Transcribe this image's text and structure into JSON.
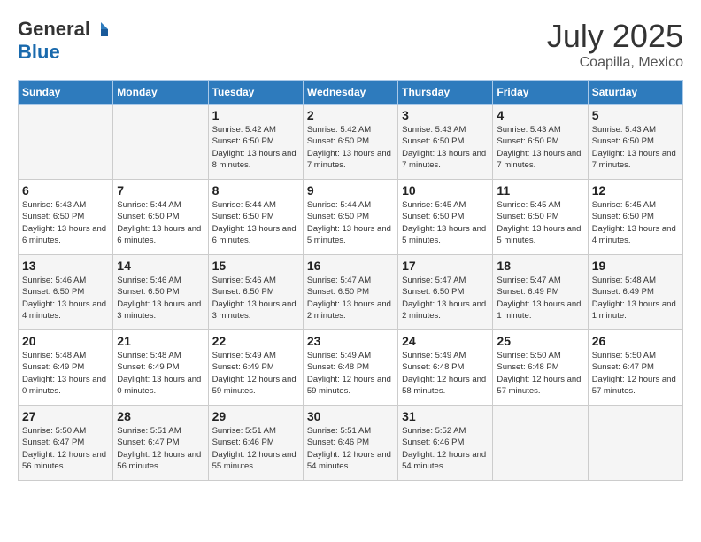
{
  "header": {
    "logo_general": "General",
    "logo_blue": "Blue",
    "title": "July 2025",
    "subtitle": "Coapilla, Mexico"
  },
  "weekdays": [
    "Sunday",
    "Monday",
    "Tuesday",
    "Wednesday",
    "Thursday",
    "Friday",
    "Saturday"
  ],
  "weeks": [
    [
      {
        "day": "",
        "detail": ""
      },
      {
        "day": "",
        "detail": ""
      },
      {
        "day": "1",
        "detail": "Sunrise: 5:42 AM\nSunset: 6:50 PM\nDaylight: 13 hours\nand 8 minutes."
      },
      {
        "day": "2",
        "detail": "Sunrise: 5:42 AM\nSunset: 6:50 PM\nDaylight: 13 hours\nand 7 minutes."
      },
      {
        "day": "3",
        "detail": "Sunrise: 5:43 AM\nSunset: 6:50 PM\nDaylight: 13 hours\nand 7 minutes."
      },
      {
        "day": "4",
        "detail": "Sunrise: 5:43 AM\nSunset: 6:50 PM\nDaylight: 13 hours\nand 7 minutes."
      },
      {
        "day": "5",
        "detail": "Sunrise: 5:43 AM\nSunset: 6:50 PM\nDaylight: 13 hours\nand 7 minutes."
      }
    ],
    [
      {
        "day": "6",
        "detail": "Sunrise: 5:43 AM\nSunset: 6:50 PM\nDaylight: 13 hours\nand 6 minutes."
      },
      {
        "day": "7",
        "detail": "Sunrise: 5:44 AM\nSunset: 6:50 PM\nDaylight: 13 hours\nand 6 minutes."
      },
      {
        "day": "8",
        "detail": "Sunrise: 5:44 AM\nSunset: 6:50 PM\nDaylight: 13 hours\nand 6 minutes."
      },
      {
        "day": "9",
        "detail": "Sunrise: 5:44 AM\nSunset: 6:50 PM\nDaylight: 13 hours\nand 5 minutes."
      },
      {
        "day": "10",
        "detail": "Sunrise: 5:45 AM\nSunset: 6:50 PM\nDaylight: 13 hours\nand 5 minutes."
      },
      {
        "day": "11",
        "detail": "Sunrise: 5:45 AM\nSunset: 6:50 PM\nDaylight: 13 hours\nand 5 minutes."
      },
      {
        "day": "12",
        "detail": "Sunrise: 5:45 AM\nSunset: 6:50 PM\nDaylight: 13 hours\nand 4 minutes."
      }
    ],
    [
      {
        "day": "13",
        "detail": "Sunrise: 5:46 AM\nSunset: 6:50 PM\nDaylight: 13 hours\nand 4 minutes."
      },
      {
        "day": "14",
        "detail": "Sunrise: 5:46 AM\nSunset: 6:50 PM\nDaylight: 13 hours\nand 3 minutes."
      },
      {
        "day": "15",
        "detail": "Sunrise: 5:46 AM\nSunset: 6:50 PM\nDaylight: 13 hours\nand 3 minutes."
      },
      {
        "day": "16",
        "detail": "Sunrise: 5:47 AM\nSunset: 6:50 PM\nDaylight: 13 hours\nand 2 minutes."
      },
      {
        "day": "17",
        "detail": "Sunrise: 5:47 AM\nSunset: 6:50 PM\nDaylight: 13 hours\nand 2 minutes."
      },
      {
        "day": "18",
        "detail": "Sunrise: 5:47 AM\nSunset: 6:49 PM\nDaylight: 13 hours\nand 1 minute."
      },
      {
        "day": "19",
        "detail": "Sunrise: 5:48 AM\nSunset: 6:49 PM\nDaylight: 13 hours\nand 1 minute."
      }
    ],
    [
      {
        "day": "20",
        "detail": "Sunrise: 5:48 AM\nSunset: 6:49 PM\nDaylight: 13 hours\nand 0 minutes."
      },
      {
        "day": "21",
        "detail": "Sunrise: 5:48 AM\nSunset: 6:49 PM\nDaylight: 13 hours\nand 0 minutes."
      },
      {
        "day": "22",
        "detail": "Sunrise: 5:49 AM\nSunset: 6:49 PM\nDaylight: 12 hours\nand 59 minutes."
      },
      {
        "day": "23",
        "detail": "Sunrise: 5:49 AM\nSunset: 6:48 PM\nDaylight: 12 hours\nand 59 minutes."
      },
      {
        "day": "24",
        "detail": "Sunrise: 5:49 AM\nSunset: 6:48 PM\nDaylight: 12 hours\nand 58 minutes."
      },
      {
        "day": "25",
        "detail": "Sunrise: 5:50 AM\nSunset: 6:48 PM\nDaylight: 12 hours\nand 57 minutes."
      },
      {
        "day": "26",
        "detail": "Sunrise: 5:50 AM\nSunset: 6:47 PM\nDaylight: 12 hours\nand 57 minutes."
      }
    ],
    [
      {
        "day": "27",
        "detail": "Sunrise: 5:50 AM\nSunset: 6:47 PM\nDaylight: 12 hours\nand 56 minutes."
      },
      {
        "day": "28",
        "detail": "Sunrise: 5:51 AM\nSunset: 6:47 PM\nDaylight: 12 hours\nand 56 minutes."
      },
      {
        "day": "29",
        "detail": "Sunrise: 5:51 AM\nSunset: 6:46 PM\nDaylight: 12 hours\nand 55 minutes."
      },
      {
        "day": "30",
        "detail": "Sunrise: 5:51 AM\nSunset: 6:46 PM\nDaylight: 12 hours\nand 54 minutes."
      },
      {
        "day": "31",
        "detail": "Sunrise: 5:52 AM\nSunset: 6:46 PM\nDaylight: 12 hours\nand 54 minutes."
      },
      {
        "day": "",
        "detail": ""
      },
      {
        "day": "",
        "detail": ""
      }
    ]
  ]
}
